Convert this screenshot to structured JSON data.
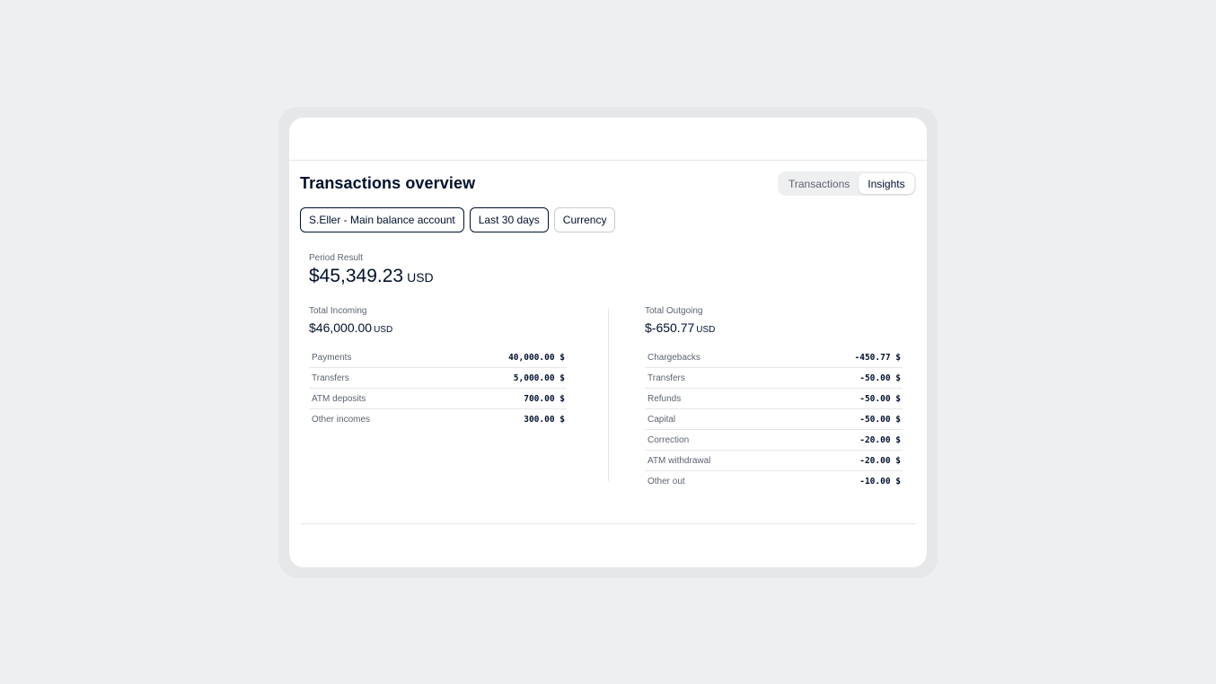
{
  "header": {
    "title": "Transactions overview",
    "tabs": [
      {
        "label": "Transactions",
        "active": false
      },
      {
        "label": "Insights",
        "active": true
      }
    ]
  },
  "filters": {
    "account": "S.Eller - Main balance account",
    "range": "Last 30 days",
    "currency": "Currency"
  },
  "period": {
    "label": "Period Result",
    "value": "$45,349.23",
    "currency": "USD"
  },
  "incoming": {
    "label": "Total Incoming",
    "value": "$46,000.00",
    "currency": "USD",
    "rows": [
      {
        "label": "Payments",
        "value": "40,000.00 $"
      },
      {
        "label": "Transfers",
        "value": "5,000.00 $"
      },
      {
        "label": "ATM deposits",
        "value": "700.00 $"
      },
      {
        "label": "Other incomes",
        "value": "300.00 $"
      }
    ]
  },
  "outgoing": {
    "label": "Total Outgoing",
    "value": "$-650.77",
    "currency": "USD",
    "rows": [
      {
        "label": "Chargebacks",
        "value": "-450.77 $"
      },
      {
        "label": "Transfers",
        "value": "-50.00 $"
      },
      {
        "label": "Refunds",
        "value": "-50.00 $"
      },
      {
        "label": "Capital",
        "value": "-50.00 $"
      },
      {
        "label": "Correction",
        "value": "-20.00 $"
      },
      {
        "label": "ATM withdrawal",
        "value": "-20.00 $"
      },
      {
        "label": "Other out",
        "value": "-10.00 $"
      }
    ]
  },
  "colors": {
    "primary_text": "#00112c",
    "secondary_text": "#5c6470",
    "background": "#eeeff0",
    "card": "#ffffff"
  }
}
